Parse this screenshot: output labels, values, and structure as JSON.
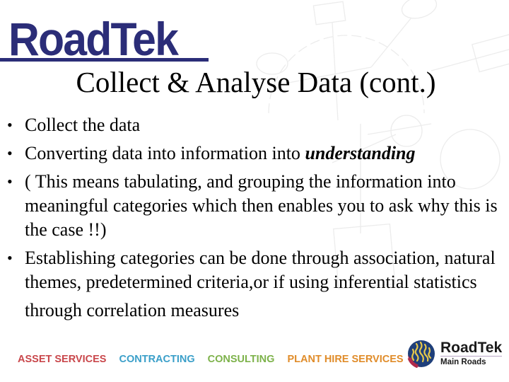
{
  "logo": {
    "text": "RoadTek",
    "color": "#2b2d78"
  },
  "title": "Collect & Analyse Data (cont.)",
  "bullets": [
    {
      "text": "Collect the data"
    },
    {
      "text_before": "Converting data into information into ",
      "emphasis": "understanding"
    },
    {
      "text": "( This means tabulating, and grouping the information into meaningful categories which then enables you to ask why this is the case !!)"
    },
    {
      "text": "Establishing categories can be done through association, natural themes, predetermined criteria,or if using inferential statistics"
    }
  ],
  "continuation": "through correlation measures",
  "footer": {
    "services": [
      {
        "label": "ASSET SERVICES",
        "color": "#c9474b"
      },
      {
        "label": "CONTRACTING",
        "color": "#3a9fc9"
      },
      {
        "label": "CONSULTING",
        "color": "#7db24a"
      },
      {
        "label": "PLANT HIRE SERVICES",
        "color": "#e08c2a"
      }
    ],
    "brand": {
      "name": "RoadTek",
      "subtitle": "Main Roads"
    }
  }
}
